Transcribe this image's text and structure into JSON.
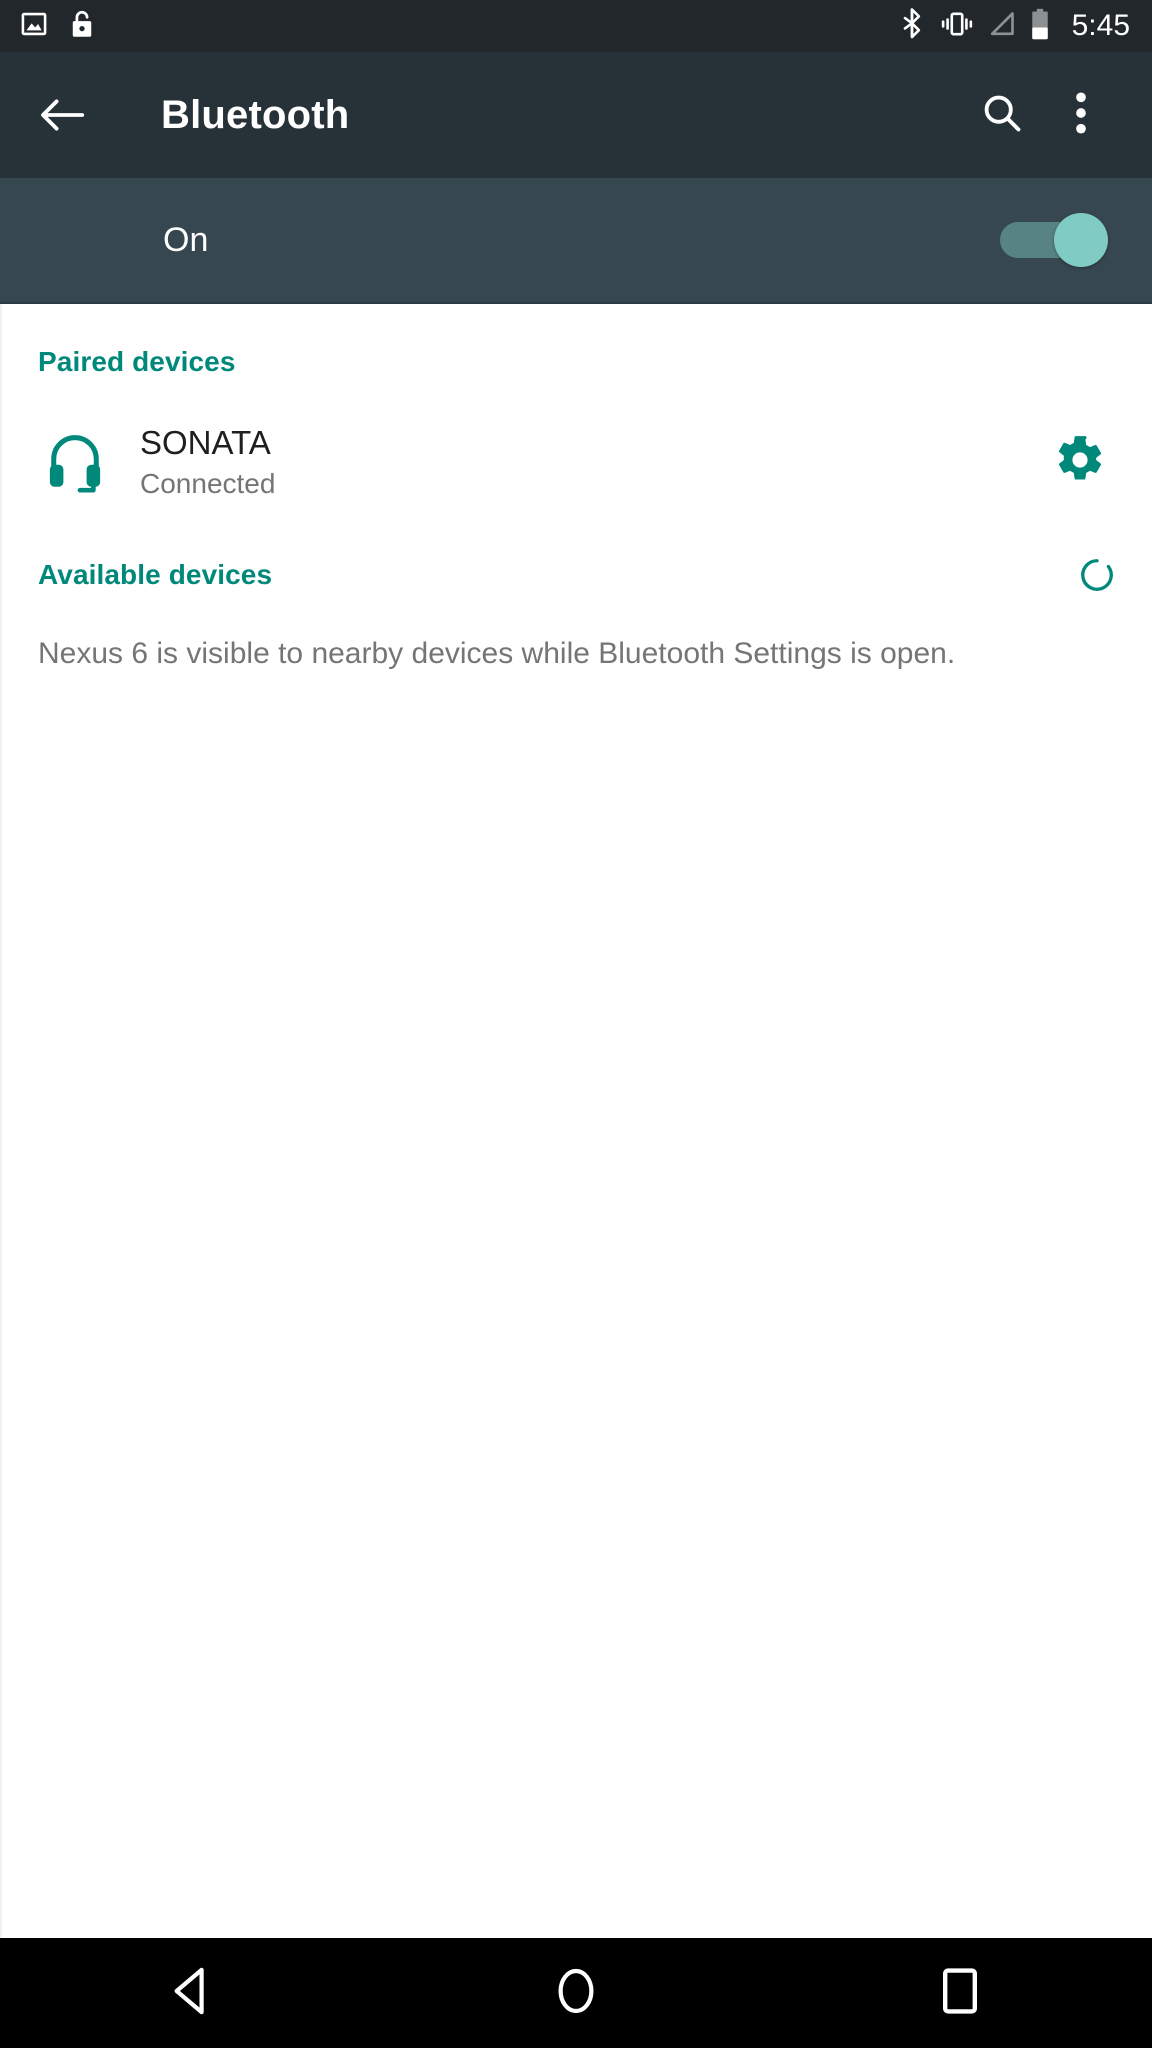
{
  "status_bar": {
    "left_icons": [
      {
        "name": "screenshot-image-icon",
        "label": "image"
      },
      {
        "name": "unlock-icon",
        "label": "unlocked"
      }
    ],
    "right_icons": [
      {
        "name": "bluetooth-icon",
        "label": "bluetooth"
      },
      {
        "name": "vibrate-icon",
        "label": "vibrate"
      },
      {
        "name": "signal-icon",
        "label": "no signal"
      },
      {
        "name": "battery-icon",
        "label": "battery"
      }
    ],
    "clock": "5:45"
  },
  "toolbar": {
    "back_icon": "arrow-back-icon",
    "title": "Bluetooth",
    "search_icon": "search-icon",
    "overflow_icon": "overflow-menu-icon"
  },
  "switch_bar": {
    "label": "On",
    "state": "on"
  },
  "sections": {
    "paired": {
      "title": "Paired devices",
      "devices": [
        {
          "icon": "headset-icon",
          "name": "SONATA",
          "status": "Connected",
          "settings_icon": "gear-icon"
        }
      ]
    },
    "available": {
      "title": "Available devices",
      "scanning_icon": "scanning-spinner-icon",
      "hint": "Nexus 6 is visible to nearby devices while Bluetooth Settings is open."
    }
  },
  "nav_bar": {
    "back": "nav-back-icon",
    "home": "nav-home-icon",
    "recents": "nav-recents-icon"
  },
  "colors": {
    "accent_teal": "#00897b",
    "toolbar": "#263238",
    "switch_bar": "#37474f",
    "status_bar": "#21272b",
    "thumb": "#80cbc4"
  }
}
